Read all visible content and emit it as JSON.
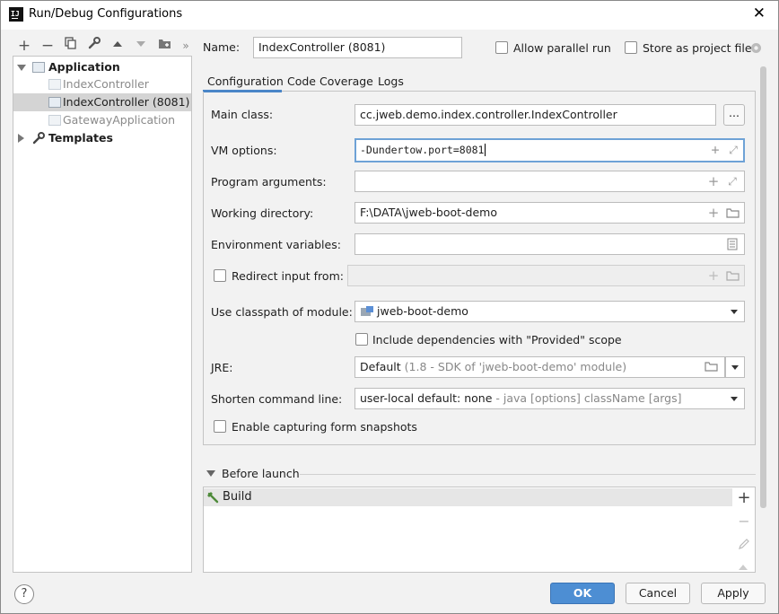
{
  "window": {
    "title": "Run/Debug Configurations",
    "app_icon": "IJ"
  },
  "toolbar": {
    "more": "»"
  },
  "tree": {
    "application_label": "Application",
    "items": [
      "IndexController",
      "IndexController (8081)",
      "GatewayApplication"
    ],
    "templates_label": "Templates"
  },
  "header": {
    "name_label": "Name:",
    "name_value": "IndexController (8081)",
    "allow_parallel": "Allow parallel run",
    "store_project": "Store as project file"
  },
  "tabs": [
    "Configuration",
    "Code Coverage",
    "Logs"
  ],
  "form": {
    "main_class_label": "Main class:",
    "main_class_value": "cc.jweb.demo.index.controller.IndexController",
    "browse": "...",
    "vm_label": "VM options:",
    "vm_value": "-Dundertow.port=8081",
    "prog_label": "Program arguments:",
    "prog_value": "",
    "workdir_label": "Working directory:",
    "workdir_value": "F:\\DATA\\jweb-boot-demo",
    "env_label": "Environment variables:",
    "env_value": "",
    "redirect_label": "Redirect input from:",
    "classpath_label": "Use classpath of module:",
    "classpath_value": "jweb-boot-demo",
    "include_deps": "Include dependencies with \"Provided\" scope",
    "jre_label": "JRE:",
    "jre_value": "Default",
    "jre_hint": "(1.8 - SDK of 'jweb-boot-demo' module)",
    "shorten_label": "Shorten command line:",
    "shorten_value": "user-local default: none",
    "shorten_hint": " - java [options] className [args]",
    "snapshots": "Enable capturing form snapshots"
  },
  "before_launch": {
    "title": "Before launch",
    "items": [
      "Build"
    ]
  },
  "buttons": {
    "help": "?",
    "ok": "OK",
    "cancel": "Cancel",
    "apply": "Apply"
  },
  "colors": {
    "accent": "#4d8ed3",
    "selection": "#d4d4d4",
    "focus": "#6ea2d6"
  }
}
